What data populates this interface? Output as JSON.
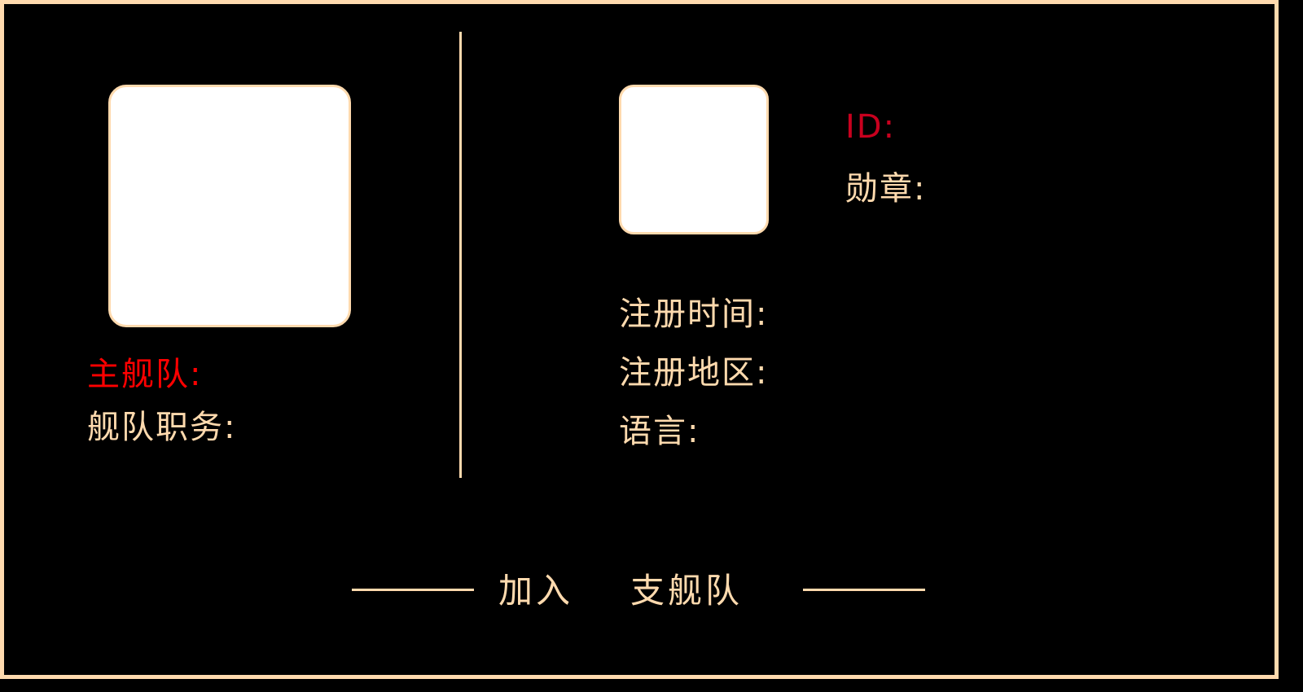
{
  "fleet": {
    "main_fleet_label": "主舰队:",
    "fleet_role_label": "舰队职务:"
  },
  "profile": {
    "id_label": "ID:",
    "medal_label": "勋章:",
    "register_time_label": "注册时间:",
    "register_region_label": "注册地区:",
    "language_label": "语言:"
  },
  "join": {
    "word1": "加入",
    "word2": "支舰队"
  },
  "colors": {
    "accent": "#FFDAAE",
    "main_fleet_label": "#FF0000",
    "id_label": "#C8001E",
    "background": "#000000"
  }
}
